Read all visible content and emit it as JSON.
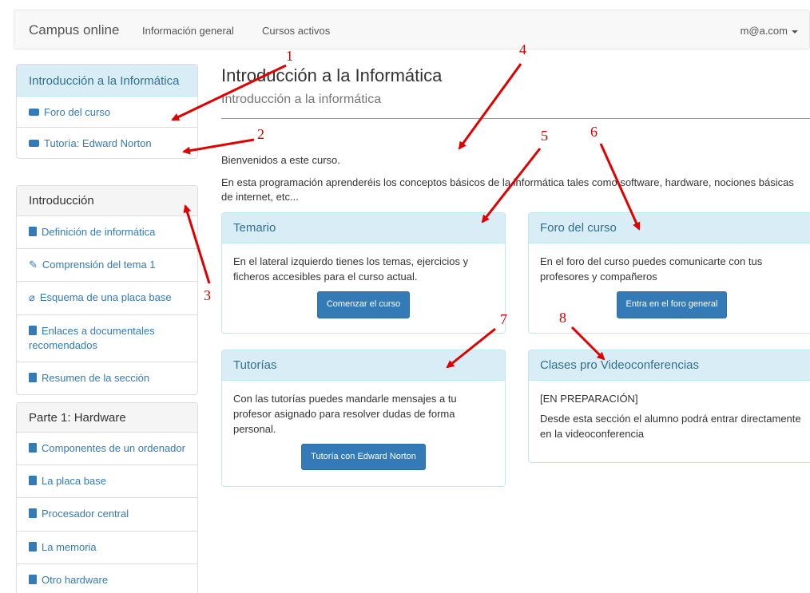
{
  "navbar": {
    "brand": "Campus online",
    "links": [
      "Información general",
      "Cursos activos"
    ],
    "user": "m@a.com"
  },
  "sidebar": {
    "course_panel": {
      "title": "Introducción a la Informática",
      "items": [
        {
          "icon": "chat-icon",
          "label": "Foro del curso"
        },
        {
          "icon": "chat-icon",
          "label": "Tutoría: Edward Norton"
        }
      ]
    },
    "intro_panel": {
      "title": "Introducción",
      "items": [
        {
          "icon": "book-icon",
          "label": "Definición de informática"
        },
        {
          "icon": "edit-icon",
          "label": "Comprensión del tema 1"
        },
        {
          "icon": "paperclip-icon",
          "label": "Esquema de una placa base"
        },
        {
          "icon": "book-icon",
          "label": "Enlaces a documentales recomendados"
        },
        {
          "icon": "book-icon",
          "label": "Resumen de la sección"
        }
      ]
    },
    "part1_panel": {
      "title": "Parte 1: Hardware",
      "items": [
        {
          "icon": "book-icon",
          "label": "Componentes de un ordenador"
        },
        {
          "icon": "book-icon",
          "label": "La placa base"
        },
        {
          "icon": "book-icon",
          "label": "Procesador central"
        },
        {
          "icon": "book-icon",
          "label": "La memoria"
        },
        {
          "icon": "book-icon",
          "label": "Otro hardware"
        }
      ]
    }
  },
  "main": {
    "title": "Introducción a la Informática",
    "subtitle": "Introducción a la informática",
    "welcome": "Bienvenidos a este curso.",
    "description": "En esta programación aprenderéis los conceptos básicos de la informática tales como software, hardware, nociones básicas de internet, etc...",
    "cards": {
      "temario": {
        "title": "Temario",
        "text": "En el lateral izquierdo tienes los temas, ejercicios y ficheros accesibles para el curso actual.",
        "button": "Comenzar el curso"
      },
      "foro": {
        "title": "Foro del curso",
        "text": "En el foro del curso puedes comunicarte con tus profesores y compañeros",
        "button": "Entra en el foro general"
      },
      "tutorias": {
        "title": "Tutorías",
        "text": "Con las tutorías puedes mandarle mensajes a tu profesor asignado para resolver dudas de forma personal.",
        "button": "Tutoría con Edward Norton"
      },
      "clases": {
        "title": "Clases pro Videoconferencias",
        "status": "[EN PREPARACIÓN]",
        "text": "Desde esta sección el alumno podrá entrar directamente en la videoconferencia"
      }
    }
  },
  "annotations": [
    "1",
    "2",
    "3",
    "4",
    "5",
    "6",
    "7",
    "8"
  ],
  "colors": {
    "link": "#337ab7",
    "panel_info": "#d9edf7",
    "annotation": "#d20000"
  }
}
